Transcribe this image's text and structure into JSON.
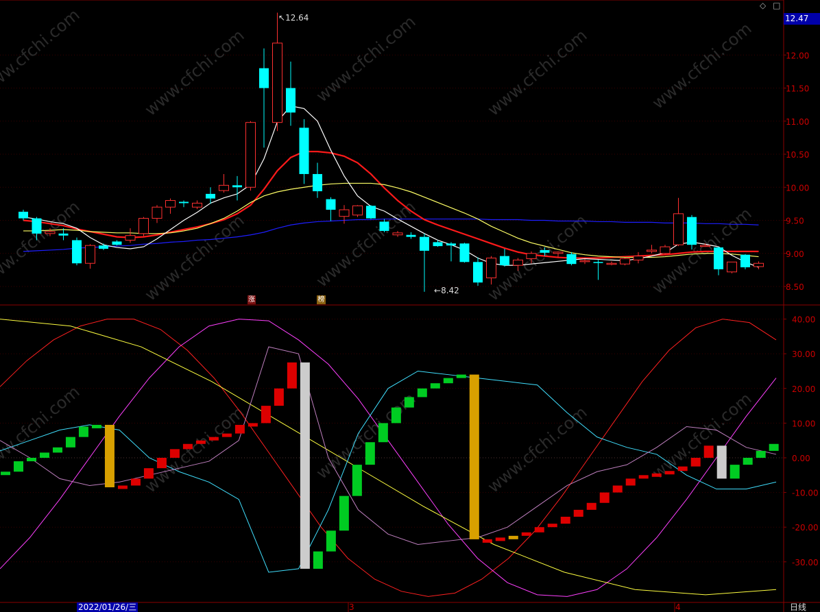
{
  "header": {
    "current_price": "12.47",
    "icons": [
      "diamond-icon",
      "square-icon"
    ]
  },
  "footer": {
    "date_label": "2022/01/26/三",
    "period_label": "日线",
    "month_ticks": [
      "3",
      "4"
    ]
  },
  "annotations": {
    "high_label": "12.64",
    "low_label": "8.42",
    "marker_zhang": "涨",
    "marker_bang": "榜"
  },
  "colors": {
    "up": "#ff3030",
    "down": "#00ffff",
    "ma5": "#ffffff",
    "ma10": "#ffff66",
    "ma20": "#ff1a1a",
    "ma60": "#1e1eff",
    "axis": "#8b0000",
    "bg": "#000000"
  },
  "chart_data": [
    {
      "type": "candlestick",
      "yticks": [
        "12.00",
        "11.50",
        "11.00",
        "10.50",
        "10.00",
        "9.50",
        "9.00",
        "8.50"
      ],
      "ylim": [
        8.2,
        12.7
      ],
      "candles": [
        {
          "o": 9.63,
          "h": 9.66,
          "l": 9.5,
          "c": 9.53
        },
        {
          "o": 9.53,
          "h": 9.55,
          "l": 9.2,
          "c": 9.3
        },
        {
          "o": 9.3,
          "h": 9.38,
          "l": 9.26,
          "c": 9.33
        },
        {
          "o": 9.3,
          "h": 9.38,
          "l": 9.2,
          "c": 9.27
        },
        {
          "o": 9.2,
          "h": 9.24,
          "l": 8.82,
          "c": 8.85
        },
        {
          "o": 8.85,
          "h": 9.14,
          "l": 8.77,
          "c": 9.12
        },
        {
          "o": 9.12,
          "h": 9.15,
          "l": 9.05,
          "c": 9.07
        },
        {
          "o": 9.18,
          "h": 9.2,
          "l": 9.12,
          "c": 9.13
        },
        {
          "o": 9.2,
          "h": 9.38,
          "l": 9.16,
          "c": 9.27
        },
        {
          "o": 9.3,
          "h": 9.55,
          "l": 9.26,
          "c": 9.53
        },
        {
          "o": 9.53,
          "h": 9.73,
          "l": 9.46,
          "c": 9.7
        },
        {
          "o": 9.7,
          "h": 9.83,
          "l": 9.6,
          "c": 9.8
        },
        {
          "o": 9.78,
          "h": 9.8,
          "l": 9.7,
          "c": 9.76
        },
        {
          "o": 9.7,
          "h": 9.8,
          "l": 9.67,
          "c": 9.76
        },
        {
          "o": 9.9,
          "h": 10.0,
          "l": 9.75,
          "c": 9.83
        },
        {
          "o": 9.95,
          "h": 10.2,
          "l": 9.92,
          "c": 10.03
        },
        {
          "o": 10.03,
          "h": 10.17,
          "l": 9.8,
          "c": 10.0
        },
        {
          "o": 10.0,
          "h": 11.0,
          "l": 9.95,
          "c": 10.98
        },
        {
          "o": 11.8,
          "h": 12.1,
          "l": 10.6,
          "c": 11.5
        },
        {
          "o": 10.98,
          "h": 12.64,
          "l": 10.85,
          "c": 12.18
        },
        {
          "o": 11.5,
          "h": 11.9,
          "l": 10.93,
          "c": 11.13
        },
        {
          "o": 10.9,
          "h": 11.03,
          "l": 10.05,
          "c": 10.2
        },
        {
          "o": 10.2,
          "h": 10.37,
          "l": 9.84,
          "c": 9.94
        },
        {
          "o": 9.82,
          "h": 9.85,
          "l": 9.49,
          "c": 9.66
        },
        {
          "o": 9.56,
          "h": 9.73,
          "l": 9.45,
          "c": 9.66
        },
        {
          "o": 9.58,
          "h": 9.73,
          "l": 9.55,
          "c": 9.72
        },
        {
          "o": 9.72,
          "h": 9.73,
          "l": 9.52,
          "c": 9.53
        },
        {
          "o": 9.48,
          "h": 9.52,
          "l": 9.32,
          "c": 9.34
        },
        {
          "o": 9.28,
          "h": 9.34,
          "l": 9.25,
          "c": 9.31
        },
        {
          "o": 9.28,
          "h": 9.32,
          "l": 9.22,
          "c": 9.25
        },
        {
          "o": 9.25,
          "h": 9.3,
          "l": 8.42,
          "c": 9.04
        },
        {
          "o": 9.17,
          "h": 9.2,
          "l": 9.1,
          "c": 9.11
        },
        {
          "o": 9.15,
          "h": 9.17,
          "l": 8.88,
          "c": 9.12
        },
        {
          "o": 9.15,
          "h": 9.16,
          "l": 8.86,
          "c": 8.87
        },
        {
          "o": 8.87,
          "h": 8.94,
          "l": 8.51,
          "c": 8.56
        },
        {
          "o": 8.63,
          "h": 8.96,
          "l": 8.53,
          "c": 8.93
        },
        {
          "o": 8.96,
          "h": 9.07,
          "l": 8.8,
          "c": 8.82
        },
        {
          "o": 8.82,
          "h": 8.93,
          "l": 8.74,
          "c": 8.9
        },
        {
          "o": 8.92,
          "h": 9.03,
          "l": 8.85,
          "c": 9.0
        },
        {
          "o": 9.05,
          "h": 9.09,
          "l": 8.96,
          "c": 9.01
        },
        {
          "o": 9.0,
          "h": 9.03,
          "l": 8.93,
          "c": 9.02
        },
        {
          "o": 8.99,
          "h": 9.02,
          "l": 8.82,
          "c": 8.84
        },
        {
          "o": 8.88,
          "h": 8.91,
          "l": 8.84,
          "c": 8.89
        },
        {
          "o": 8.87,
          "h": 8.9,
          "l": 8.6,
          "c": 8.86
        },
        {
          "o": 8.84,
          "h": 8.88,
          "l": 8.82,
          "c": 8.85
        },
        {
          "o": 8.84,
          "h": 8.93,
          "l": 8.82,
          "c": 8.92
        },
        {
          "o": 8.9,
          "h": 9.02,
          "l": 8.85,
          "c": 8.96
        },
        {
          "o": 9.03,
          "h": 9.13,
          "l": 9.0,
          "c": 9.05
        },
        {
          "o": 9.0,
          "h": 9.13,
          "l": 8.98,
          "c": 9.1
        },
        {
          "o": 9.13,
          "h": 9.84,
          "l": 9.11,
          "c": 9.6
        },
        {
          "o": 9.55,
          "h": 9.58,
          "l": 9.06,
          "c": 9.13
        },
        {
          "o": 9.12,
          "h": 9.15,
          "l": 9.1,
          "c": 9.12
        },
        {
          "o": 9.09,
          "h": 9.1,
          "l": 8.67,
          "c": 8.76
        },
        {
          "o": 8.72,
          "h": 8.86,
          "l": 8.7,
          "c": 8.87
        },
        {
          "o": 8.98,
          "h": 8.99,
          "l": 8.76,
          "c": 8.79
        },
        {
          "o": 8.8,
          "h": 8.88,
          "l": 8.76,
          "c": 8.85
        }
      ],
      "series": [
        {
          "name": "",
          "color": "#ffffff",
          "values": [
            9.55,
            9.52,
            9.48,
            9.45,
            9.38,
            9.24,
            9.13,
            9.09,
            9.07,
            9.1,
            9.22,
            9.36,
            9.5,
            9.62,
            9.76,
            9.84,
            9.9,
            10.04,
            10.43,
            10.99,
            11.23,
            11.19,
            11.0,
            10.56,
            10.17,
            9.87,
            9.71,
            9.64,
            9.52,
            9.41,
            9.3,
            9.2,
            9.13,
            9.05,
            8.93,
            8.85,
            8.82,
            8.82,
            8.84,
            8.86,
            8.88,
            8.9,
            8.92,
            8.91,
            8.9,
            8.89,
            8.92,
            8.96,
            9.01,
            9.14,
            9.17,
            9.14,
            9.1,
            8.97,
            8.87,
            8.79
          ]
        },
        {
          "name": "",
          "color": "#ffff66",
          "values": [
            9.34,
            9.34,
            9.35,
            9.36,
            9.35,
            9.33,
            9.32,
            9.31,
            9.31,
            9.3,
            9.3,
            9.31,
            9.34,
            9.38,
            9.45,
            9.53,
            9.64,
            9.77,
            9.87,
            9.93,
            9.97,
            10.0,
            10.03,
            10.05,
            10.06,
            10.06,
            10.06,
            10.04,
            9.99,
            9.93,
            9.85,
            9.77,
            9.69,
            9.61,
            9.52,
            9.41,
            9.32,
            9.23,
            9.16,
            9.11,
            9.06,
            9.01,
            8.98,
            8.96,
            8.95,
            8.94,
            8.94,
            8.94,
            8.95,
            8.97,
            8.99,
            9.0,
            9.0,
            8.99,
            8.97,
            8.95
          ]
        },
        {
          "name": "",
          "color": "#ff1a1a",
          "values": [
            9.5,
            9.48,
            9.45,
            9.42,
            9.37,
            9.33,
            9.29,
            9.25,
            9.24,
            9.25,
            9.28,
            9.32,
            9.36,
            9.4,
            9.45,
            9.51,
            9.6,
            9.73,
            9.97,
            10.25,
            10.45,
            10.54,
            10.54,
            10.52,
            10.47,
            10.37,
            10.2,
            9.99,
            9.8,
            9.64,
            9.51,
            9.43,
            9.36,
            9.29,
            9.22,
            9.15,
            9.08,
            9.02,
            8.98,
            8.96,
            8.94,
            8.93,
            8.93,
            8.93,
            8.94,
            8.95,
            8.96,
            8.97,
            8.98,
            9.0,
            9.02,
            9.03,
            9.03,
            9.03,
            9.03,
            9.03
          ]
        },
        {
          "name": "",
          "color": "#1e1eff",
          "values": [
            9.03,
            9.04,
            9.05,
            9.06,
            9.08,
            9.09,
            9.1,
            9.11,
            9.12,
            9.14,
            9.15,
            9.17,
            9.18,
            9.2,
            9.21,
            9.23,
            9.25,
            9.28,
            9.32,
            9.38,
            9.43,
            9.46,
            9.48,
            9.49,
            9.5,
            9.51,
            9.51,
            9.52,
            9.52,
            9.52,
            9.52,
            9.52,
            9.52,
            9.52,
            9.52,
            9.51,
            9.51,
            9.51,
            9.5,
            9.5,
            9.49,
            9.49,
            9.49,
            9.48,
            9.48,
            9.47,
            9.47,
            9.47,
            9.46,
            9.46,
            9.46,
            9.45,
            9.45,
            9.44,
            9.44,
            9.43
          ]
        }
      ]
    },
    {
      "type": "bar",
      "yticks": [
        "40.00",
        "30.00",
        "20.00",
        "10.00",
        "0.00",
        "-10.00",
        "-20.00",
        "-30.00"
      ],
      "ylim": [
        -40,
        40
      ],
      "values": [
        -4,
        -1,
        0,
        1.5,
        3,
        6,
        9,
        9.5,
        -8.5,
        -8,
        -6,
        -3,
        0,
        2.5,
        4,
        5,
        6,
        7,
        9.5,
        10,
        15,
        20,
        27.5,
        -32,
        -27,
        -21,
        -11,
        -2,
        4.5,
        10,
        14.5,
        17.5,
        20,
        21.5,
        23,
        24,
        -23.5,
        -23.5,
        -23,
        -22.5,
        -21.5,
        -20,
        -19,
        -17,
        -15,
        -13,
        -10,
        -8,
        -6,
        -5,
        -4.5,
        -3.8,
        -2.5,
        0,
        3.5,
        -6,
        -2,
        0,
        2,
        4
      ],
      "colors": [
        "g",
        "g",
        "g",
        "g",
        "g",
        "g",
        "g",
        "g",
        "y",
        "r",
        "r",
        "r",
        "r",
        "r",
        "r",
        "r",
        "r",
        "r",
        "r",
        "r",
        "r",
        "r",
        "r",
        "w",
        "g",
        "g",
        "g",
        "g",
        "g",
        "g",
        "g",
        "g",
        "g",
        "g",
        "g",
        "g",
        "y",
        "r",
        "r",
        "y",
        "r",
        "r",
        "r",
        "r",
        "r",
        "r",
        "r",
        "r",
        "r",
        "r",
        "r",
        "r",
        "r",
        "r",
        "r",
        "w",
        "g",
        "g",
        "g",
        "g"
      ],
      "series": [
        {
          "name": "",
          "color": "#ff2020",
          "values": [
            20.5,
            28,
            34,
            38,
            40,
            40,
            37,
            31,
            23,
            13,
            2,
            -9,
            -20,
            -29,
            -35,
            -38.5,
            -40,
            -39,
            -35,
            -29,
            -21,
            -11,
            0,
            11,
            22,
            31,
            37.5,
            40,
            39,
            34
          ]
        },
        {
          "name": "",
          "color": "#ff40ff",
          "values": [
            -32,
            -23,
            -12,
            0,
            12,
            23,
            32,
            38,
            40,
            39.5,
            34,
            27,
            17,
            5,
            -7,
            -19,
            -29,
            -36,
            -39.5,
            -40,
            -38,
            -32,
            -23,
            -12,
            0,
            12,
            23
          ]
        },
        {
          "name": "",
          "color": "#ffff40",
          "values": [
            40,
            38,
            32,
            22,
            10,
            -2,
            -14,
            -25,
            -33,
            -38,
            -39.5,
            -38
          ]
        },
        {
          "name": "",
          "color": "#40e0ff",
          "values": [
            2,
            5,
            8,
            9.5,
            8,
            0,
            -4,
            -7,
            -12,
            -33,
            -32,
            -15,
            7,
            20,
            25,
            24,
            23,
            22,
            21,
            13,
            6,
            3,
            1,
            -5,
            -9,
            -9,
            -7
          ]
        },
        {
          "name": "",
          "color": "#c080c0",
          "values": [
            5,
            0,
            -6,
            -8,
            -7,
            -5,
            -3,
            -1,
            5,
            32,
            30,
            0,
            -15,
            -22,
            -25,
            -24,
            -23,
            -20,
            -14,
            -8,
            -4,
            -2,
            3,
            9,
            8,
            3,
            1
          ]
        }
      ]
    }
  ]
}
